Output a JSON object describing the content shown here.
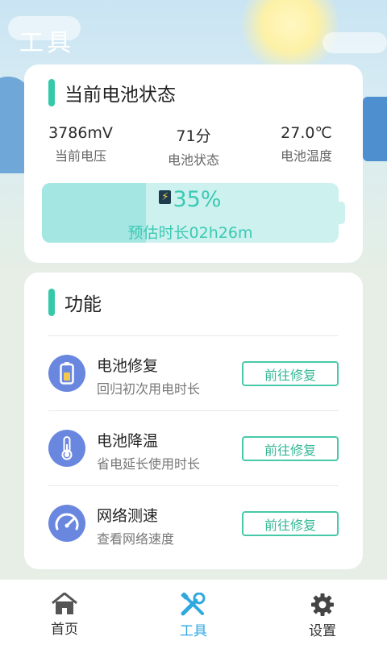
{
  "header": {
    "title": "工具"
  },
  "battery": {
    "section_title": "当前电池状态",
    "stats": [
      {
        "value": "3786mV",
        "label": "当前电压"
      },
      {
        "value": "71分",
        "label": "电池状态"
      },
      {
        "value": "27.0℃",
        "label": "电池温度"
      }
    ],
    "level_percent": 35,
    "level_text": "35%",
    "estimate": "预估时长02h26m"
  },
  "functions": {
    "section_title": "功能",
    "items": [
      {
        "name": "电池修复",
        "desc": "回归初次用电时长",
        "button": "前往修复",
        "icon": "battery-icon"
      },
      {
        "name": "电池降温",
        "desc": "省电延长使用时长",
        "button": "前往修复",
        "icon": "thermometer-icon"
      },
      {
        "name": "网络测速",
        "desc": "查看网络速度",
        "button": "前往修复",
        "icon": "speedometer-icon"
      }
    ]
  },
  "tabs": [
    {
      "label": "首页",
      "icon": "home-icon",
      "active": false
    },
    {
      "label": "工具",
      "icon": "tools-icon",
      "active": true
    },
    {
      "label": "设置",
      "icon": "gear-icon",
      "active": false
    }
  ],
  "colors": {
    "accent": "#35c9a9",
    "active_tab": "#2fa8e0",
    "icon_bg": "#6a87e0",
    "battery_track": "#ccf1ef",
    "battery_fill": "#a4e6e2"
  }
}
